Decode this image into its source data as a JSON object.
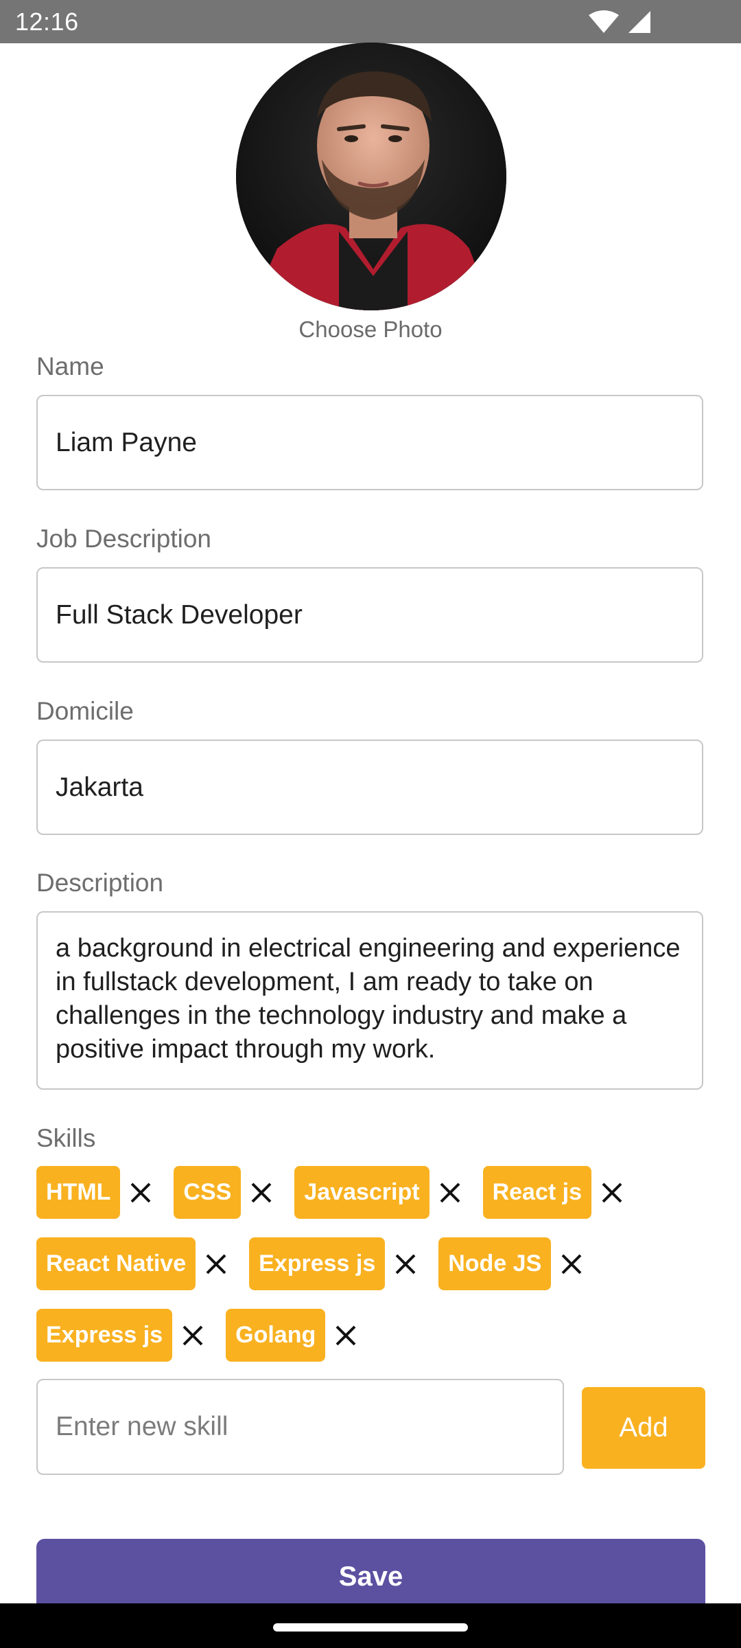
{
  "status_bar": {
    "time": "12:16",
    "icons": [
      "wifi-icon",
      "signal-icon"
    ]
  },
  "profile": {
    "photo_label": "Choose Photo"
  },
  "fields": {
    "name": {
      "label": "Name",
      "value": "Liam Payne"
    },
    "job": {
      "label": "Job Description",
      "value": "Full Stack Developer"
    },
    "domicile": {
      "label": "Domicile",
      "value": "Jakarta"
    },
    "description": {
      "label": "Description",
      "value": "a background in electrical engineering and experience in fullstack development, I am ready to take on challenges in the technology industry and make a positive impact through my work."
    }
  },
  "skills": {
    "label": "Skills",
    "items": [
      "HTML",
      "CSS",
      "Javascript",
      "React js",
      "React Native",
      "Express js",
      "Node JS",
      "Express js",
      "Golang"
    ],
    "new_skill_placeholder": "Enter new skill",
    "add_label": "Add"
  },
  "actions": {
    "save_label": "Save"
  },
  "colors": {
    "status_bar": "#757575",
    "accent": "#f9b120",
    "primary": "#5c50a1",
    "input_border": "#c7c7c7",
    "label": "#6d6d6d"
  }
}
